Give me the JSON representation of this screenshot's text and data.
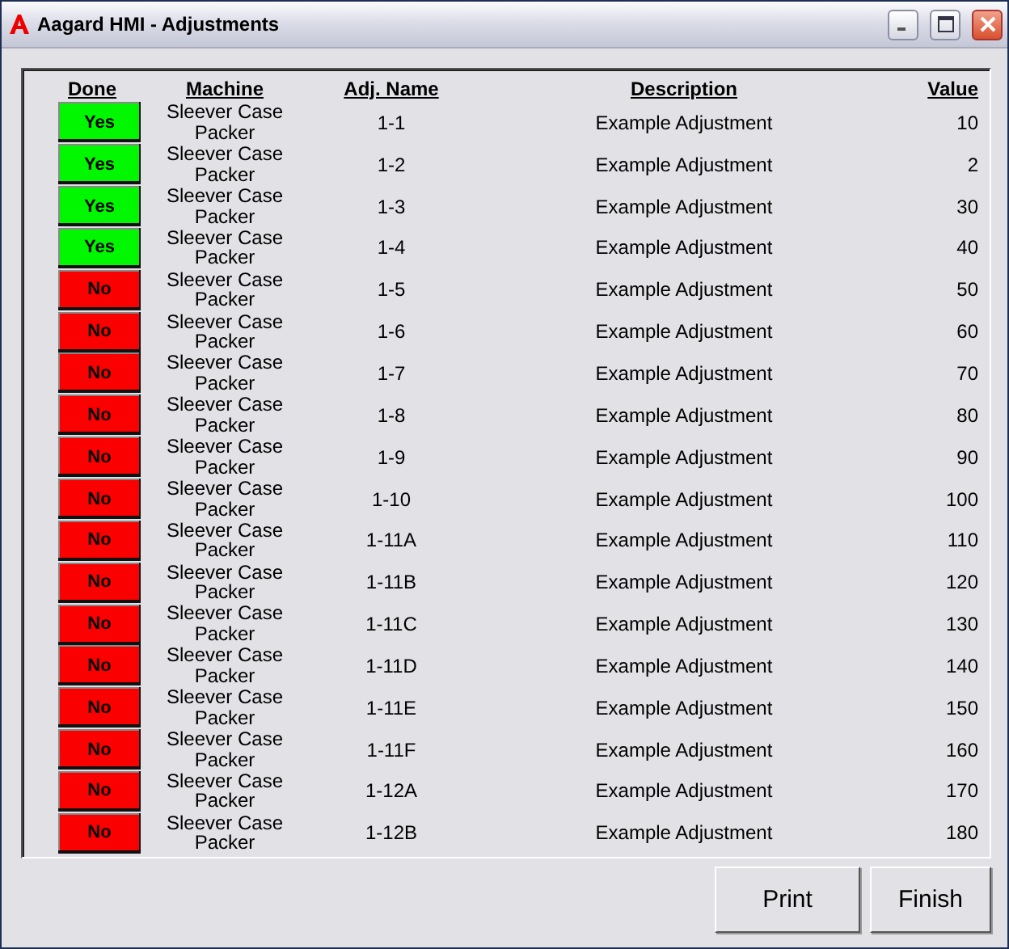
{
  "window": {
    "title": "Aagard HMI - Adjustments"
  },
  "table": {
    "columns": [
      "Done",
      "Machine",
      "Adj. Name",
      "Description",
      "Value"
    ],
    "rows": [
      {
        "done": true,
        "status": "Yes",
        "machine": "Sleever Case Packer",
        "name": "1-1",
        "description": "Example Adjustment",
        "value": "10"
      },
      {
        "done": true,
        "status": "Yes",
        "machine": "Sleever Case Packer",
        "name": "1-2",
        "description": "Example Adjustment",
        "value": "2"
      },
      {
        "done": true,
        "status": "Yes",
        "machine": "Sleever Case Packer",
        "name": "1-3",
        "description": "Example Adjustment",
        "value": "30"
      },
      {
        "done": true,
        "status": "Yes",
        "machine": "Sleever Case Packer",
        "name": "1-4",
        "description": "Example Adjustment",
        "value": "40"
      },
      {
        "done": false,
        "status": "No",
        "machine": "Sleever Case Packer",
        "name": "1-5",
        "description": "Example Adjustment",
        "value": "50"
      },
      {
        "done": false,
        "status": "No",
        "machine": "Sleever Case Packer",
        "name": "1-6",
        "description": "Example Adjustment",
        "value": "60"
      },
      {
        "done": false,
        "status": "No",
        "machine": "Sleever Case Packer",
        "name": "1-7",
        "description": "Example Adjustment",
        "value": "70"
      },
      {
        "done": false,
        "status": "No",
        "machine": "Sleever Case Packer",
        "name": "1-8",
        "description": "Example Adjustment",
        "value": "80"
      },
      {
        "done": false,
        "status": "No",
        "machine": "Sleever Case Packer",
        "name": "1-9",
        "description": "Example Adjustment",
        "value": "90"
      },
      {
        "done": false,
        "status": "No",
        "machine": "Sleever Case Packer",
        "name": "1-10",
        "description": "Example Adjustment",
        "value": "100"
      },
      {
        "done": false,
        "status": "No",
        "machine": "Sleever Case Packer",
        "name": "1-11A",
        "description": "Example Adjustment",
        "value": "110"
      },
      {
        "done": false,
        "status": "No",
        "machine": "Sleever Case Packer",
        "name": "1-11B",
        "description": "Example Adjustment",
        "value": "120"
      },
      {
        "done": false,
        "status": "No",
        "machine": "Sleever Case Packer",
        "name": "1-11C",
        "description": "Example Adjustment",
        "value": "130"
      },
      {
        "done": false,
        "status": "No",
        "machine": "Sleever Case Packer",
        "name": "1-11D",
        "description": "Example Adjustment",
        "value": "140"
      },
      {
        "done": false,
        "status": "No",
        "machine": "Sleever Case Packer",
        "name": "1-11E",
        "description": "Example Adjustment",
        "value": "150"
      },
      {
        "done": false,
        "status": "No",
        "machine": "Sleever Case Packer",
        "name": "1-11F",
        "description": "Example Adjustment",
        "value": "160"
      },
      {
        "done": false,
        "status": "No",
        "machine": "Sleever Case Packer",
        "name": "1-12A",
        "description": "Example Adjustment",
        "value": "170"
      },
      {
        "done": false,
        "status": "No",
        "machine": "Sleever Case Packer",
        "name": "1-12B",
        "description": "Example Adjustment",
        "value": "180"
      }
    ]
  },
  "buttons": [
    "Print",
    "Finish"
  ]
}
